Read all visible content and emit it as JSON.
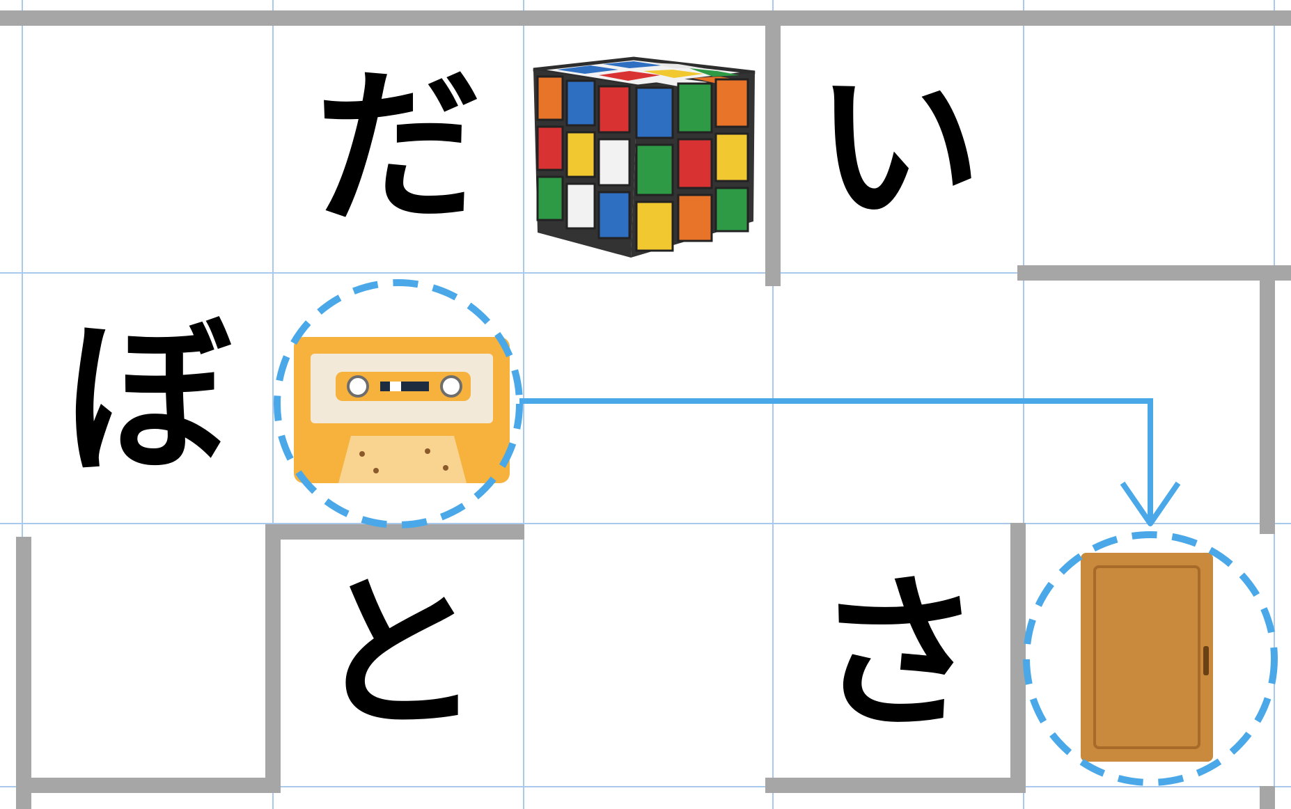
{
  "puzzle": {
    "cells": [
      {
        "id": "r0c1",
        "kana": "だ"
      },
      {
        "id": "r0c3",
        "kana": "い"
      },
      {
        "id": "r1c0",
        "kana": "ぼ"
      },
      {
        "id": "r2c1",
        "kana": "と"
      },
      {
        "id": "r2c3",
        "kana": "さ"
      }
    ],
    "icons": [
      "rubiks-cube",
      "cassette-tape",
      "door"
    ],
    "highlighted": [
      "cassette-tape",
      "door"
    ]
  },
  "colors": {
    "grid_line": "#a8c8ec",
    "wall": "#a6a6a6",
    "path": "#4aa8e8",
    "kana": "#000000"
  }
}
